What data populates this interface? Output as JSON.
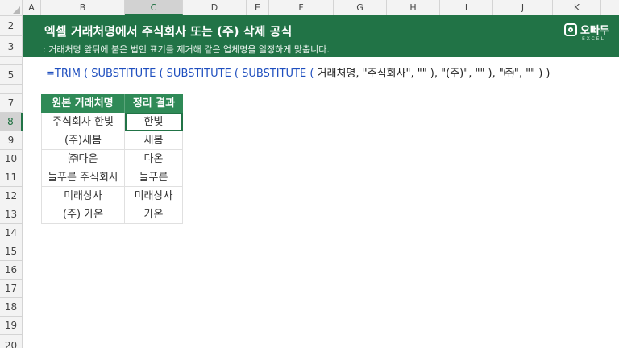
{
  "columns": [
    "A",
    "B",
    "C",
    "D",
    "E",
    "F",
    "G",
    "H",
    "I",
    "J",
    "K"
  ],
  "selected_column": "C",
  "rows": [
    "2",
    "3",
    "5",
    "7",
    "8",
    "9",
    "10",
    "11",
    "12",
    "13",
    "14",
    "15",
    "16",
    "17",
    "18",
    "19",
    "20"
  ],
  "selected_row": "8",
  "banner": {
    "title": "엑셀 거래처명에서 주식회사 또는 (주) 삭제 공식",
    "subtitle": ": 거래처명 앞뒤에 붙은 법인 표기를 제거해 같은 업체명을 일정하게 맞춥니다.",
    "logo_name": "오빠두",
    "logo_tag": "EXCEL"
  },
  "formula": {
    "part1": "=TRIM ( SUBSTITUTE ( SUBSTITUTE ( SUBSTITUTE ( ",
    "part2": "거래처명, \"주식회사\", \"\" ), \"(주)\", \"\" ), \"㈜\", \"\" ) )"
  },
  "table": {
    "headers": [
      "원본 거래처명",
      "정리 결과"
    ],
    "rows": [
      [
        "주식회사 한빛",
        "한빛"
      ],
      [
        "(주)새봄",
        "새봄"
      ],
      [
        "㈜다온",
        "다온"
      ],
      [
        "늘푸른 주식회사",
        "늘푸른"
      ],
      [
        "미래상사",
        "미래상사"
      ],
      [
        "(주) 가온",
        "가온"
      ]
    ]
  },
  "colors": {
    "banner": "#217346",
    "table_header": "#2f8a57",
    "formula_function": "#1f4fbf"
  }
}
